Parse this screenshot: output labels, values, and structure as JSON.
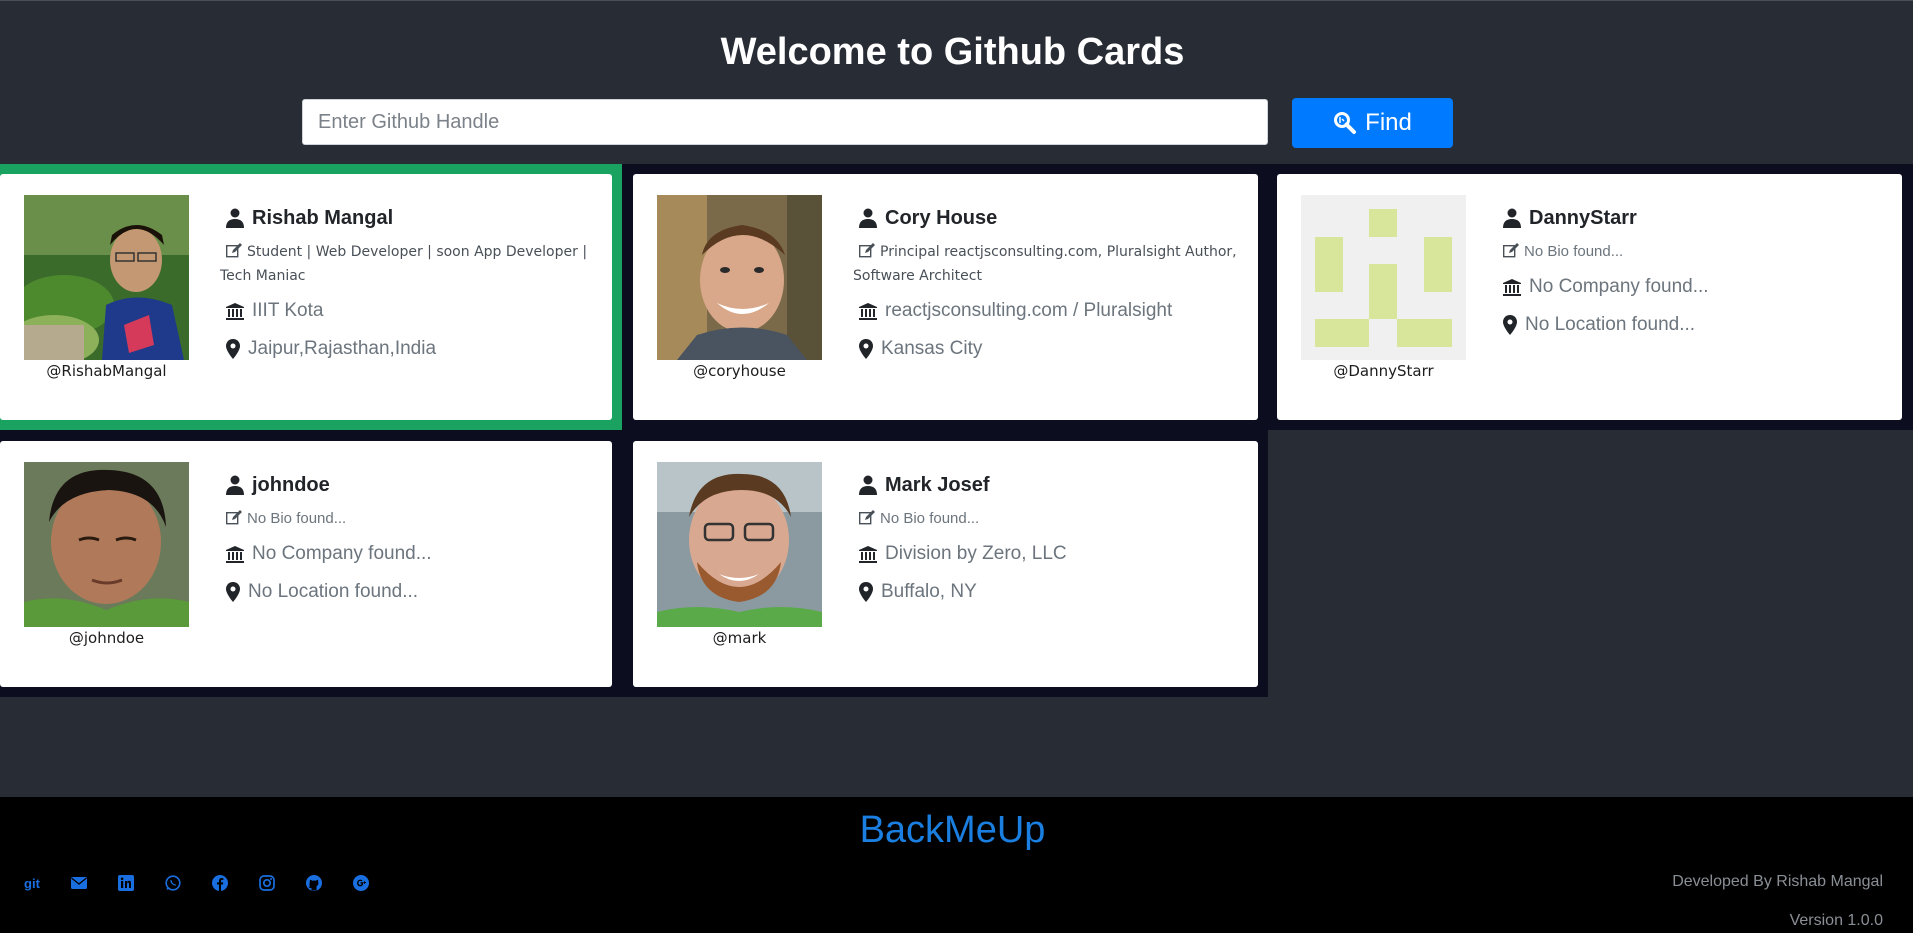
{
  "header": {
    "title": "Welcome to Github Cards",
    "search_placeholder": "Enter Github Handle",
    "search_value": "",
    "find_label": "Find"
  },
  "cards": [
    {
      "name": "Rishab Mangal",
      "bio": "Student | Web Developer | soon App Developer | Tech Maniac",
      "company": "IIIT Kota",
      "location": "Jaipur,Rajasthan,India",
      "handle": "@RishabMangal",
      "highlighted": true
    },
    {
      "name": "Cory House",
      "bio": "Principal reactjsconsulting.com, Pluralsight Author, Software Architect",
      "company": "reactjsconsulting.com / Pluralsight",
      "location": "Kansas City",
      "handle": "@coryhouse",
      "highlighted": false
    },
    {
      "name": "DannyStarr",
      "bio": "No Bio found...",
      "company": "No Company found...",
      "location": "No Location found...",
      "handle": "@DannyStarr",
      "highlighted": false
    },
    {
      "name": "johndoe",
      "bio": "No Bio found...",
      "company": "No Company found...",
      "location": "No Location found...",
      "handle": "@johndoe",
      "highlighted": false
    },
    {
      "name": "Mark Josef",
      "bio": "No Bio found...",
      "company": "Division by Zero, LLC",
      "location": "Buffalo, NY",
      "handle": "@mark",
      "highlighted": false
    }
  ],
  "footer": {
    "brand": "BackMeUp",
    "git_label": "git",
    "social_icons": [
      "git-icon",
      "email-icon",
      "linkedin-icon",
      "whatsapp-icon",
      "facebook-icon",
      "instagram-icon",
      "github-icon",
      "google-plus-icon"
    ],
    "developer": "Developed By Rishab Mangal",
    "version": "Version 1.0.0"
  },
  "colors": {
    "background": "#282c34",
    "accent": "#007bff",
    "highlight": "#1aa260",
    "footer": "#000000"
  }
}
